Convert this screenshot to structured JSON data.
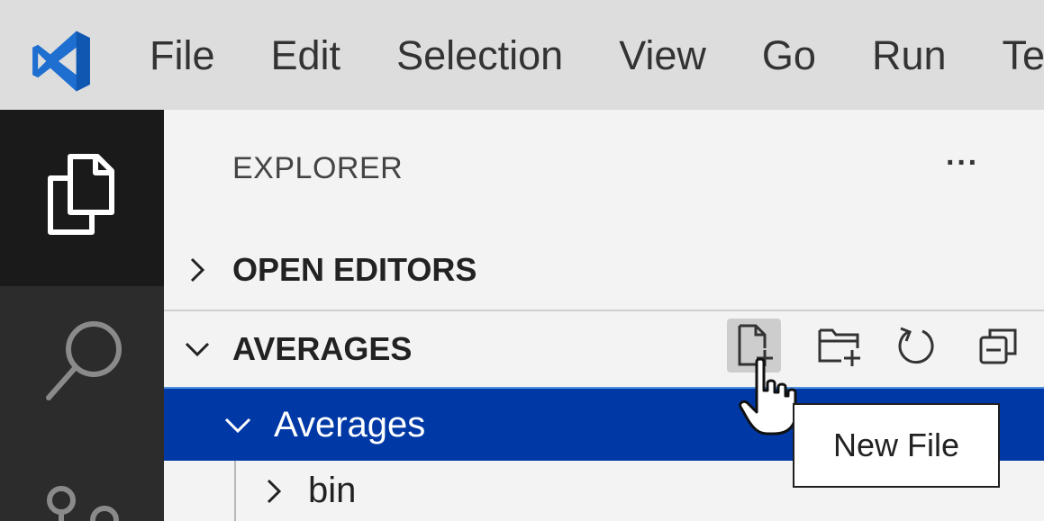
{
  "menu": {
    "items": [
      "File",
      "Edit",
      "Selection",
      "View",
      "Go",
      "Run",
      "Te"
    ]
  },
  "activity_bar": {
    "icons": [
      "explorer-icon",
      "search-icon",
      "source-control-icon"
    ]
  },
  "sidebar": {
    "title": "EXPLORER",
    "more_label": "···",
    "sections": [
      {
        "label": "OPEN EDITORS",
        "expanded": false
      },
      {
        "label": "AVERAGES",
        "expanded": true
      }
    ],
    "actions": [
      "new-file-icon",
      "new-folder-icon",
      "refresh-icon",
      "collapse-all-icon"
    ],
    "tree": [
      {
        "label": "Averages",
        "expanded": true,
        "selected": true
      },
      {
        "label": "bin",
        "expanded": false,
        "selected": false
      }
    ]
  },
  "tooltip": {
    "text": "New File"
  },
  "colors": {
    "titlebar": "#dddddd",
    "activity_bar": "#2c2c2c",
    "sidebar": "#f3f3f3",
    "selection": "#0039a6",
    "vscode_blue": "#1f6fd1"
  }
}
